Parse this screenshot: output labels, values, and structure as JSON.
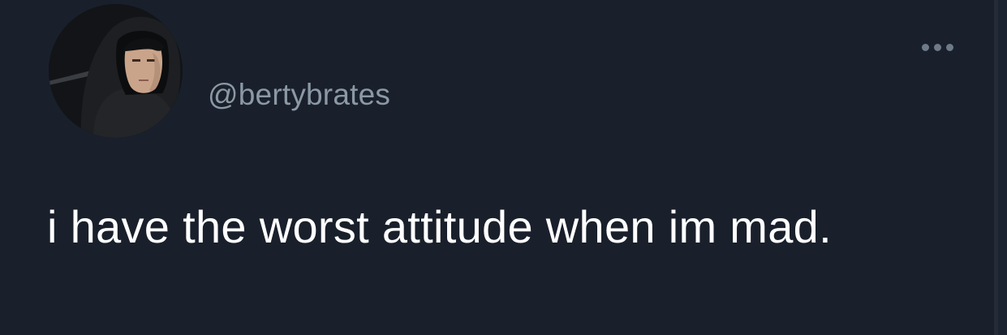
{
  "tweet": {
    "username": "@bertybrates",
    "text": "i have the worst attitude when im mad.",
    "more_icon": "more-horizontal-icon",
    "avatar_icon": "avatar-photo"
  },
  "colors": {
    "background": "#19202b",
    "username": "#8b98a5",
    "text": "#ffffff",
    "icon": "#6e7a88"
  }
}
